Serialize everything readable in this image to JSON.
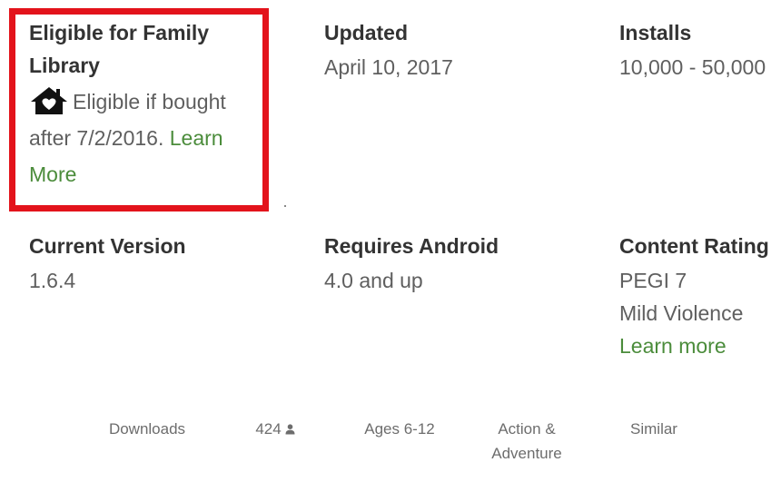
{
  "family_library": {
    "label": "Eligible for Family Library",
    "description": "Eligible if bought after 7/2/2016.",
    "link": "Learn More",
    "icon": "family-library-house-heart-icon"
  },
  "updated": {
    "label": "Updated",
    "value": "April 10, 2017"
  },
  "installs": {
    "label": "Installs",
    "value": "10,000 - 50,000"
  },
  "current_version": {
    "label": "Current Version",
    "value": "1.6.4"
  },
  "requires_android": {
    "label": "Requires Android",
    "value": "4.0 and up"
  },
  "content_rating": {
    "label": "Content Rating",
    "rating": "PEGI 7",
    "descriptor": "Mild Violence",
    "link": "Learn more"
  },
  "bottom_bar": {
    "downloads": "Downloads",
    "rating_count": "424",
    "rating_icon": "person-icon",
    "age": "Ages 6-12",
    "genre_line1": "Action &",
    "genre_line2": "Adventure",
    "similar": "Similar"
  },
  "colors": {
    "highlight_border": "#e3131b",
    "link_green": "#4b8c3b",
    "label_text": "#333333",
    "value_text": "#5f5f5f"
  }
}
